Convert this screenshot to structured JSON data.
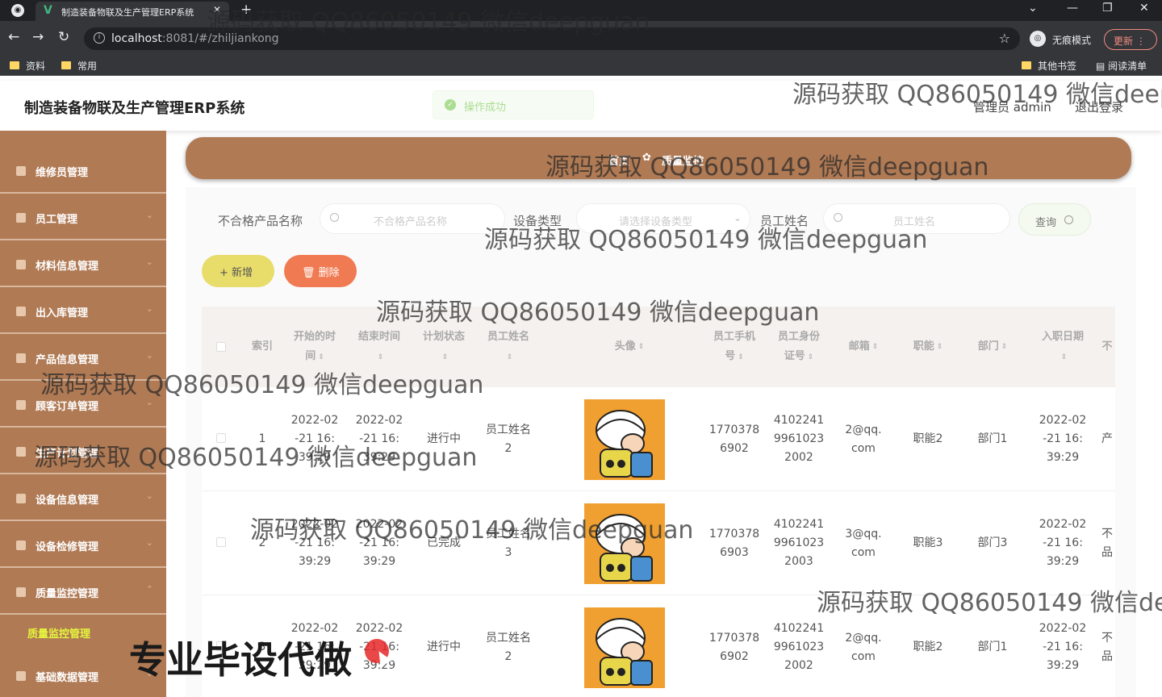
{
  "browser": {
    "tab_title": "制造装备物联及生产管理ERP系统",
    "url_host": "localhost",
    "url_rest": ":8081/#/zhiljiankong",
    "incognito_label": "无痕模式",
    "update_label": "更新",
    "bookmarks": [
      "资料",
      "常用",
      "其他书签",
      "阅读清单"
    ]
  },
  "header": {
    "app_title": "制造装备物联及生产管理ERP系统",
    "toast": "操作成功",
    "admin_label": "管理员 admin",
    "logout": "退出登录"
  },
  "sidebar": {
    "items": [
      {
        "label": "维修员管理"
      },
      {
        "label": "员工管理"
      },
      {
        "label": "材料信息管理"
      },
      {
        "label": "出入库管理"
      },
      {
        "label": "产品信息管理"
      },
      {
        "label": "顾客订单管理"
      },
      {
        "label": "生产计划管理"
      },
      {
        "label": "设备信息管理"
      },
      {
        "label": "设备检修管理"
      },
      {
        "label": "质量监控管理"
      },
      {
        "label": "基础数据管理"
      }
    ],
    "active_sub": "质量监控管理"
  },
  "breadcrumb": {
    "home": "首页",
    "current": "质量监控"
  },
  "filters": {
    "product_label": "不合格产品名称",
    "product_placeholder": "不合格产品名称",
    "device_label": "设备类型",
    "device_placeholder": "请选择设备类型",
    "employee_label": "员工姓名",
    "employee_placeholder": "员工姓名",
    "query_label": "查询"
  },
  "actions": {
    "add": "+ 新增",
    "delete": "删除"
  },
  "table": {
    "headers": {
      "index": "索引",
      "start_a": "开始的时",
      "start_b": "间",
      "end": "结束时间",
      "status": "计划状态",
      "name": "员工姓名",
      "avatar": "头像",
      "phone_a": "员工手机",
      "phone_b": "号",
      "idcard_a": "员工身份",
      "idcard_b": "证号",
      "email": "邮箱",
      "func": "职能",
      "dept": "部门",
      "hire": "入职日期",
      "last": "不"
    },
    "rows": [
      {
        "index": "1",
        "start": "2022-02-21 16:39:29",
        "end": "2022-02-21 16:39:29",
        "status": "进行中",
        "name": "员工姓名2",
        "phone": "17703786902",
        "idcard": "410224199610232002",
        "email": "2@qq.com",
        "func": "职能2",
        "dept": "部门1",
        "hire": "2022-02-21 16:39:29",
        "last": "产"
      },
      {
        "index": "2",
        "start": "2022-02-21 16:39:29",
        "end": "2022-02-21 16:39:29",
        "status": "已完成",
        "name": "员工姓名3",
        "phone": "17703786903",
        "idcard": "410224199610232003",
        "email": "3@qq.com",
        "func": "职能3",
        "dept": "部门3",
        "hire": "2022-02-21 16:39:29",
        "last": "不品"
      },
      {
        "index": "3",
        "start": "2022-02-21 16:39:29",
        "end": "2022-02-21 16:39:29",
        "status": "进行中",
        "name": "员工姓名2",
        "phone": "17703786902",
        "idcard": "410224199610232002",
        "email": "2@qq.com",
        "func": "职能2",
        "dept": "部门1",
        "hire": "2022-02-21 16:39:29",
        "last": "不品"
      }
    ]
  },
  "watermark_text": "源码获取 QQ86050149 微信deepguan",
  "promo_text": "专业毕设代做",
  "colors": {
    "sidebar": "#b07a54",
    "active_sub": "#e5f53d",
    "add_btn": "#e8dc6a",
    "delete_btn": "#f07a52"
  }
}
